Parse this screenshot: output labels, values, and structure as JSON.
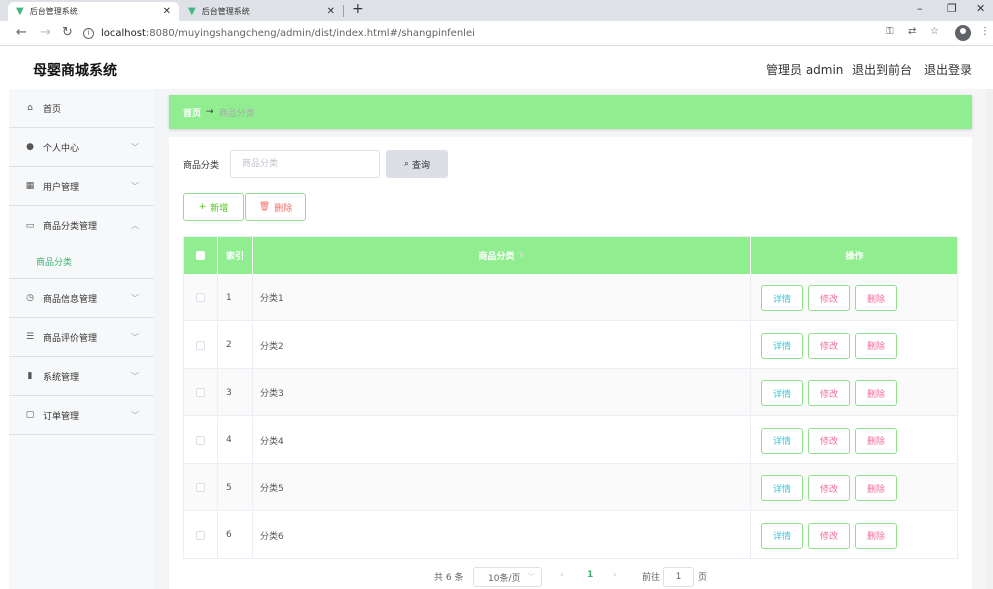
{
  "browser": {
    "tabs": [
      {
        "title": "后台管理系统",
        "active": true
      },
      {
        "title": "后台管理系统",
        "active": false
      }
    ],
    "new_tab": "+",
    "url_host": "localhost",
    "url_rest": ":8080/muyingshangcheng/admin/dist/index.html#/shangpinfenlei"
  },
  "header": {
    "title": "母婴商城系统",
    "user": "管理员 admin",
    "to_front": "退出到前台",
    "logout": "退出登录"
  },
  "sidebar": {
    "items": [
      {
        "label": "首页",
        "icon": "home-icon"
      },
      {
        "label": "个人中心",
        "icon": "user-icon"
      },
      {
        "label": "用户管理",
        "icon": "grid-icon"
      },
      {
        "label": "商品分类管理",
        "icon": "card-icon"
      },
      {
        "label": "商品信息管理",
        "icon": "clock-icon"
      },
      {
        "label": "商品评价管理",
        "icon": "sliders-icon"
      },
      {
        "label": "系统管理",
        "icon": "chart-icon"
      },
      {
        "label": "订单管理",
        "icon": "message-icon"
      }
    ],
    "sub_active": "商品分类"
  },
  "breadcrumb": {
    "home": "首页",
    "current": "商品分类"
  },
  "search": {
    "label": "商品分类",
    "placeholder": "商品分类",
    "button": "查询"
  },
  "actions": {
    "add": "新增",
    "delete": "删除"
  },
  "table": {
    "columns": [
      "索引",
      "商品分类",
      "操作"
    ],
    "rows": [
      {
        "index": "1",
        "name": "分类1"
      },
      {
        "index": "2",
        "name": "分类2"
      },
      {
        "index": "3",
        "name": "分类3"
      },
      {
        "index": "4",
        "name": "分类4"
      },
      {
        "index": "5",
        "name": "分类5"
      },
      {
        "index": "6",
        "name": "分类6"
      }
    ],
    "row_actions": {
      "detail": "详情",
      "edit": "修改",
      "delete": "删除"
    }
  },
  "pagination": {
    "total": "共 6 条",
    "page_size": "10条/页",
    "current": "1",
    "goto_label": "前往",
    "goto_value": "1",
    "page_suffix": "页"
  },
  "colors": {
    "accent_green": "#90ee90",
    "active_text": "#3cb371"
  }
}
